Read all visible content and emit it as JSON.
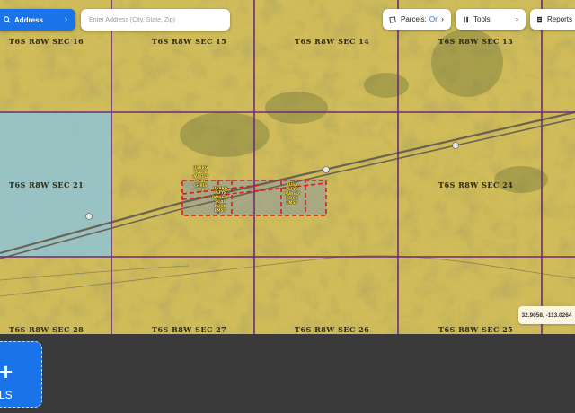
{
  "header": {
    "address_button": {
      "label": "Address",
      "icon": "search-icon"
    },
    "search": {
      "placeholder": "Enter Address (City, State, Zip)",
      "value": ""
    },
    "parcels": {
      "label": "Parcels:",
      "state": "On",
      "icon": "parcel-icon"
    },
    "tools": {
      "label": "Tools",
      "icon": "tools-icon"
    },
    "reports": {
      "label": "Reports",
      "icon": "reports-icon"
    }
  },
  "map": {
    "coordinates": "32.9058, -113.0264",
    "sections": {
      "s16": "T6S R8W SEC 16",
      "s15": "T6S R8W SEC 15",
      "s14": "T6S R8W SEC 14",
      "s13": "T6S R8W SEC 13",
      "s21": "T6S R8W SEC 21",
      "s24": "T6S R8W SEC 24",
      "s28": "T6S R8W SEC 28",
      "s27": "T6S R8W SEC 27",
      "s26": "T6S R8W SEC 26",
      "s25": "T6S R8W SEC 25"
    },
    "colors": {
      "parcel_fill": "#d7c15a",
      "section_line": "#6e2a7a",
      "selected_area": "#8fc3d6",
      "highlight_border": "#e0191e"
    }
  },
  "bottom": {
    "add_card": {
      "symbol": "+",
      "caption": "LS"
    }
  }
}
